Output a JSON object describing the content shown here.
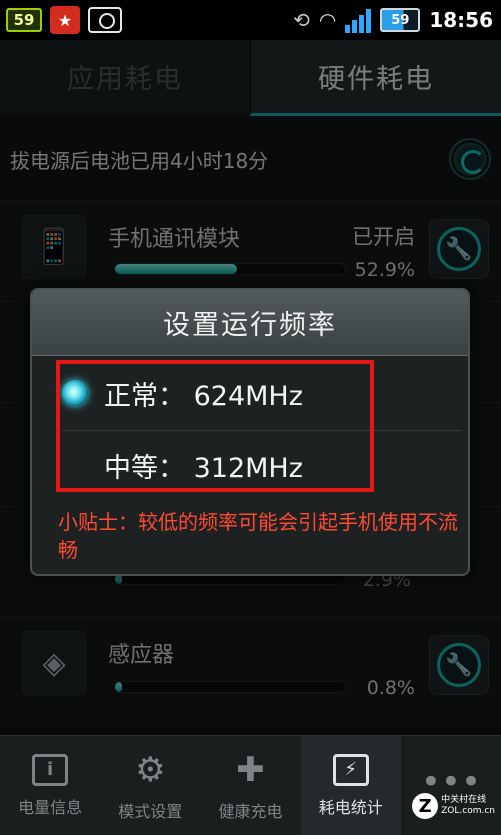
{
  "status_bar": {
    "left_badge": "59",
    "battery_level": "59",
    "time": "18:56"
  },
  "tabs": [
    {
      "label": "应用耗电",
      "active": false
    },
    {
      "label": "硬件耗电",
      "active": true
    }
  ],
  "summary": {
    "text": "拔电源后电池已用4小时18分"
  },
  "items": [
    {
      "icon": "phone-radio-icon",
      "title": "手机通讯模块",
      "status": "已开启",
      "percent_label": "52.9%",
      "fill": 0.529
    },
    {
      "icon": "sensor-icon",
      "title": "感应器",
      "status": "",
      "percent_label": "0.8%",
      "fill": 0.008
    }
  ],
  "partial_rows": [
    {
      "percent_label": "2.9%",
      "fill": 0.029
    }
  ],
  "dialog": {
    "title": "设置运行频率",
    "options": [
      {
        "label": "正常： 624MHz",
        "selected": true
      },
      {
        "label": "中等： 312MHz",
        "selected": false
      }
    ],
    "tip": "小贴士：较低的频率可能会引起手机使用不流畅"
  },
  "bottom_nav": [
    {
      "label": "电量信息",
      "icon": "battery-info-icon",
      "active": false
    },
    {
      "label": "模式设置",
      "icon": "gear-icon",
      "active": false
    },
    {
      "label": "健康充电",
      "icon": "plus-icon",
      "active": false
    },
    {
      "label": "耗电统计",
      "icon": "lightning-icon",
      "active": true
    },
    {
      "label": "",
      "icon": "more-icon",
      "active": false
    }
  ],
  "watermark": {
    "logo": "Z",
    "line1": "中关村在线",
    "line2": "ZOL.com.cn"
  },
  "colors": {
    "accent": "#14a7a0",
    "highlight": "#e41616",
    "tip": "#ff4a32"
  }
}
